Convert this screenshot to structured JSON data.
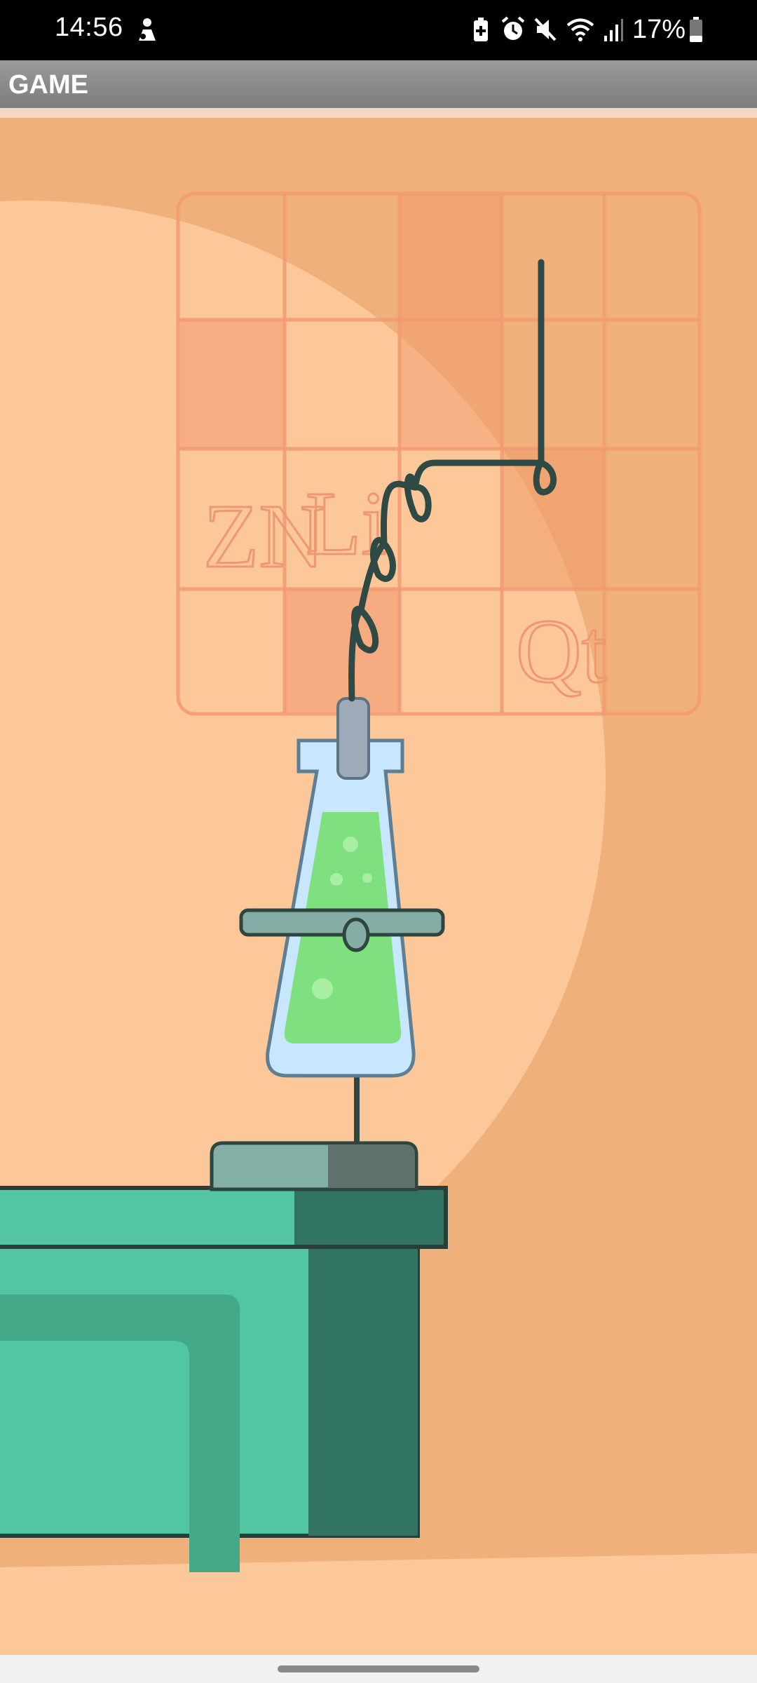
{
  "status_bar": {
    "time": "14:56",
    "battery_percent": "17%",
    "icons": [
      "person-notification-icon",
      "battery-saver-icon",
      "alarm-icon",
      "mute-icon",
      "wifi-icon",
      "signal-icon",
      "battery-icon"
    ]
  },
  "app_bar": {
    "title": "GAME"
  },
  "scene": {
    "chart_tiles": [
      "ZN",
      "Li",
      "Qt"
    ],
    "colors": {
      "background": "#f0b07b",
      "spotlight": "#fcc799",
      "table_green": "#52c6a2",
      "table_dark": "#317461",
      "liquid": "#7ee07f",
      "flask_glass": "#c8e7ff"
    }
  }
}
